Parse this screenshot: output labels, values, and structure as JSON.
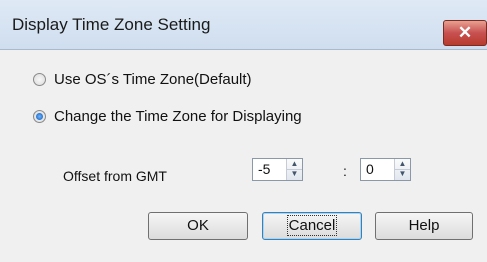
{
  "window": {
    "title": "Display Time Zone Setting",
    "close_glyph": "✕"
  },
  "options": [
    {
      "label": "Use OS´s Time Zone(Default)",
      "checked": false
    },
    {
      "label": "Change the Time Zone for Displaying",
      "checked": true
    }
  ],
  "offset": {
    "label": "Offset from GMT",
    "hours": "-5",
    "minutes": "0",
    "separator": ":"
  },
  "buttons": {
    "ok": "OK",
    "cancel": "Cancel",
    "help": "Help"
  },
  "colors": {
    "title_bar": "#cfdeef",
    "dialog_bg": "#f0f0f0",
    "close_button": "#c75050",
    "radio_selected": "#0a56b8"
  }
}
